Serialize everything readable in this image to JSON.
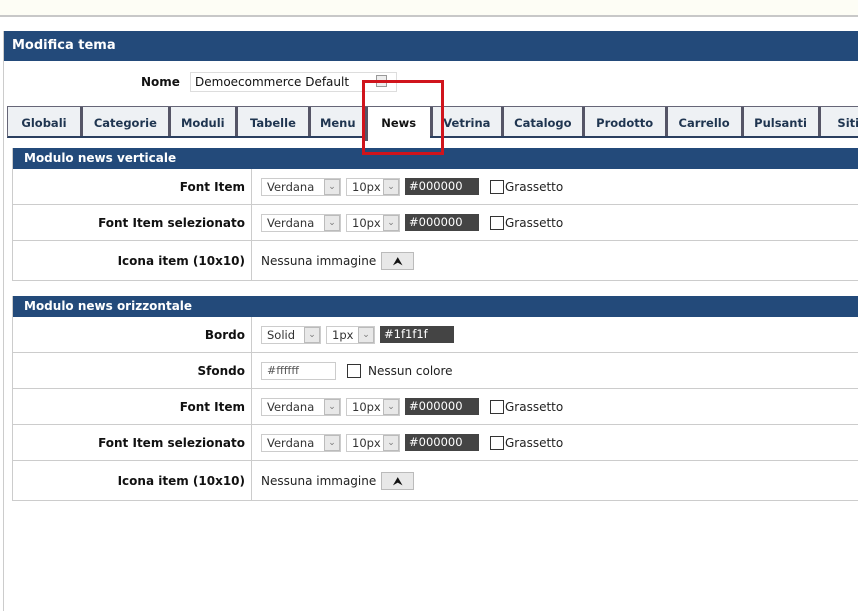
{
  "panel": {
    "title": "Modifica tema",
    "nome_label": "Nome",
    "nome_value": "Demoecommerce Default"
  },
  "tabs": [
    {
      "label": "Globali",
      "w": 74
    },
    {
      "label": "Categorie",
      "w": 90
    },
    {
      "label": "Moduli",
      "w": 69
    },
    {
      "label": "Tabelle",
      "w": 75
    },
    {
      "label": "Menu",
      "w": 58
    },
    {
      "label": "News",
      "w": 67,
      "active": true
    },
    {
      "label": "Vetrina",
      "w": 73
    },
    {
      "label": "Catalogo",
      "w": 83
    },
    {
      "label": "Prodotto",
      "w": 85
    },
    {
      "label": "Carrello",
      "w": 78
    },
    {
      "label": "Pulsanti",
      "w": 79
    },
    {
      "label": "Siti",
      "w": 60
    }
  ],
  "sections": [
    {
      "title": "Modulo news verticale",
      "rows": [
        {
          "type": "font",
          "label": "Font Item",
          "font": "Verdana",
          "size": "10px",
          "color": "#000000",
          "check": "Grassetto",
          "h": 36
        },
        {
          "type": "font",
          "label": "Font Item selezionato",
          "font": "Verdana",
          "size": "10px",
          "color": "#000000",
          "check": "Grassetto",
          "h": 36
        },
        {
          "type": "image",
          "label": "Icona item (10x10)",
          "text": "Nessuna immagine",
          "h": 40
        }
      ]
    },
    {
      "title": "Modulo news orizzontale",
      "rows": [
        {
          "type": "border",
          "label": "Bordo",
          "style": "Solid",
          "size": "1px",
          "color": "#1f1f1f",
          "h": 36
        },
        {
          "type": "bg",
          "label": "Sfondo",
          "color": "#ffffff",
          "check": "Nessun colore",
          "h": 36
        },
        {
          "type": "font",
          "label": "Font Item",
          "font": "Verdana",
          "size": "10px",
          "color": "#000000",
          "check": "Grassetto",
          "h": 36
        },
        {
          "type": "font",
          "label": "Font Item selezionato",
          "font": "Verdana",
          "size": "10px",
          "color": "#000000",
          "check": "Grassetto",
          "h": 36
        },
        {
          "type": "image",
          "label": "Icona item (10x10)",
          "text": "Nessuna immagine",
          "h": 40
        }
      ]
    }
  ],
  "colors": {
    "header": "#234a7a",
    "highlight": "#d0141c"
  },
  "icons": {
    "upload": "upload-icon",
    "dropdown": "chevron-down-icon"
  }
}
